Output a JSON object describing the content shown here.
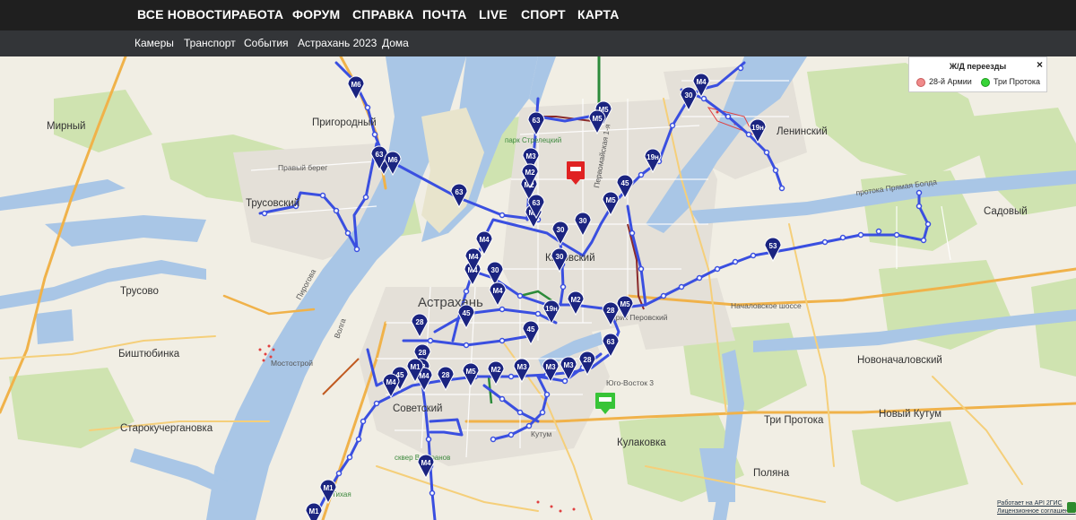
{
  "nav": {
    "main": [
      "ВСЕ НОВОСТИ",
      "РАБОТА",
      "ФОРУМ",
      "СПРАВКА",
      "ПОЧТА",
      "LIVE",
      "СПОРТ",
      "КАРТА"
    ],
    "sub": [
      "Камеры",
      "Транспорт",
      "События",
      "Астрахань 2023",
      "Дома"
    ]
  },
  "legend": {
    "title": "Ж/Д переезды",
    "close": "×",
    "items": [
      {
        "label": "28-й Армии",
        "color": "#f08a8a"
      },
      {
        "label": "Три Протока",
        "color": "#37d437"
      }
    ]
  },
  "map": {
    "places": [
      "Мирный",
      "Пригородный",
      "Правый берег",
      "Трусовский",
      "Трусово",
      "Биштюбинка",
      "Старокучергановка",
      "Советский",
      "Кировский",
      "Астрахань",
      "Ленинский",
      "Садовый",
      "Новоначаловский",
      "Три Протока",
      "Новый Кутум",
      "Кулаковка",
      "Поляна",
      "Юго-Восток 3",
      "Кутум",
      "Мостострой",
      "Пирогова",
      "Волга",
      "парк Стрелецкий",
      "сквер Ветеранов",
      "Тихая",
      "Началовское шоссе",
      "протока Прямая Болда",
      "Первомайская 1-я",
      "ерик Перовский"
    ],
    "route_labels": [
      "М6",
      "М6",
      "63",
      "М6",
      "63",
      "63",
      "М5",
      "М5",
      "М3",
      "М1",
      "М2",
      "М2",
      "М5",
      "30",
      "М4",
      "30",
      "19н",
      "19н",
      "45",
      "М5",
      "30",
      "М4",
      "30",
      "М4",
      "30",
      "53",
      "М4",
      "М4",
      "63",
      "45",
      "М2",
      "М5",
      "28",
      "28",
      "19н",
      "45",
      "28",
      "28",
      "45",
      "М2",
      "М4",
      "М5",
      "28",
      "М1",
      "М2",
      "М3",
      "М3",
      "М3",
      "28",
      "63",
      "М4",
      "М4",
      "М1",
      "М1"
    ],
    "route_color": "#3a4fe0",
    "marker_color": "#1b2480"
  },
  "attribution": {
    "line1": "Работает на API 2ГИС",
    "line2": "Лицензионное соглашение"
  }
}
